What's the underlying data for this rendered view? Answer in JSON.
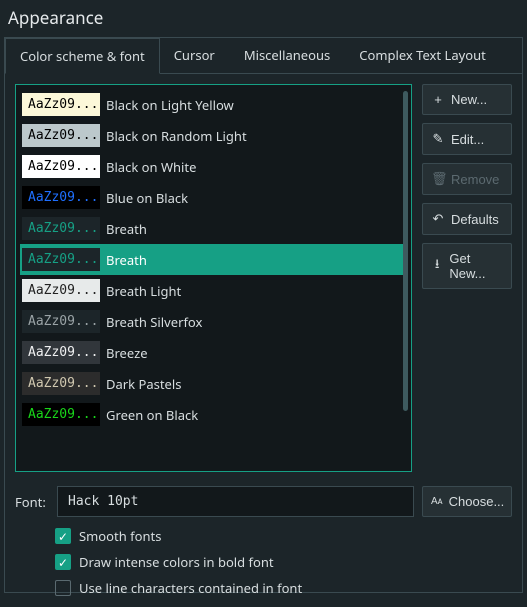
{
  "title": "Appearance",
  "tabs": [
    "Color scheme & font",
    "Cursor",
    "Miscellaneous",
    "Complex Text Layout"
  ],
  "active_tab": 0,
  "sample": "AaZz09...",
  "schemes": [
    {
      "name": "Black on Light Yellow",
      "bg": "#fcf8d9",
      "fg": "#000000"
    },
    {
      "name": "Black on Random Light",
      "bg": "#bcc8cb",
      "fg": "#000000"
    },
    {
      "name": "Black on White",
      "bg": "#ffffff",
      "fg": "#000000"
    },
    {
      "name": "Blue on Black",
      "bg": "#000000",
      "fg": "#1e6fff"
    },
    {
      "name": "Breath",
      "bg": "#1c2529",
      "fg": "#16a085"
    },
    {
      "name": "Breath",
      "bg": "#1c2529",
      "fg": "#16a085",
      "selected": true
    },
    {
      "name": "Breath Light",
      "bg": "#e7eaea",
      "fg": "#222222"
    },
    {
      "name": "Breath Silverfox",
      "bg": "#1c2529",
      "fg": "#9aa3a6"
    },
    {
      "name": "Breeze",
      "bg": "#31363b",
      "fg": "#eff0f1"
    },
    {
      "name": "Dark Pastels",
      "bg": "#2c2c2c",
      "fg": "#d0c8b0"
    },
    {
      "name": "Green on Black",
      "bg": "#000000",
      "fg": "#19d61a"
    }
  ],
  "buttons": {
    "new": "New...",
    "edit": "Edit...",
    "remove": "Remove",
    "defaults": "Defaults",
    "getnew": "Get New..."
  },
  "font_label": "Font:",
  "font_value": "Hack 10pt",
  "choose": "Choose...",
  "checks": [
    {
      "label": "Smooth fonts",
      "checked": true
    },
    {
      "label": "Draw intense colors in bold font",
      "checked": true
    },
    {
      "label": "Use line characters contained in font",
      "checked": false
    }
  ]
}
